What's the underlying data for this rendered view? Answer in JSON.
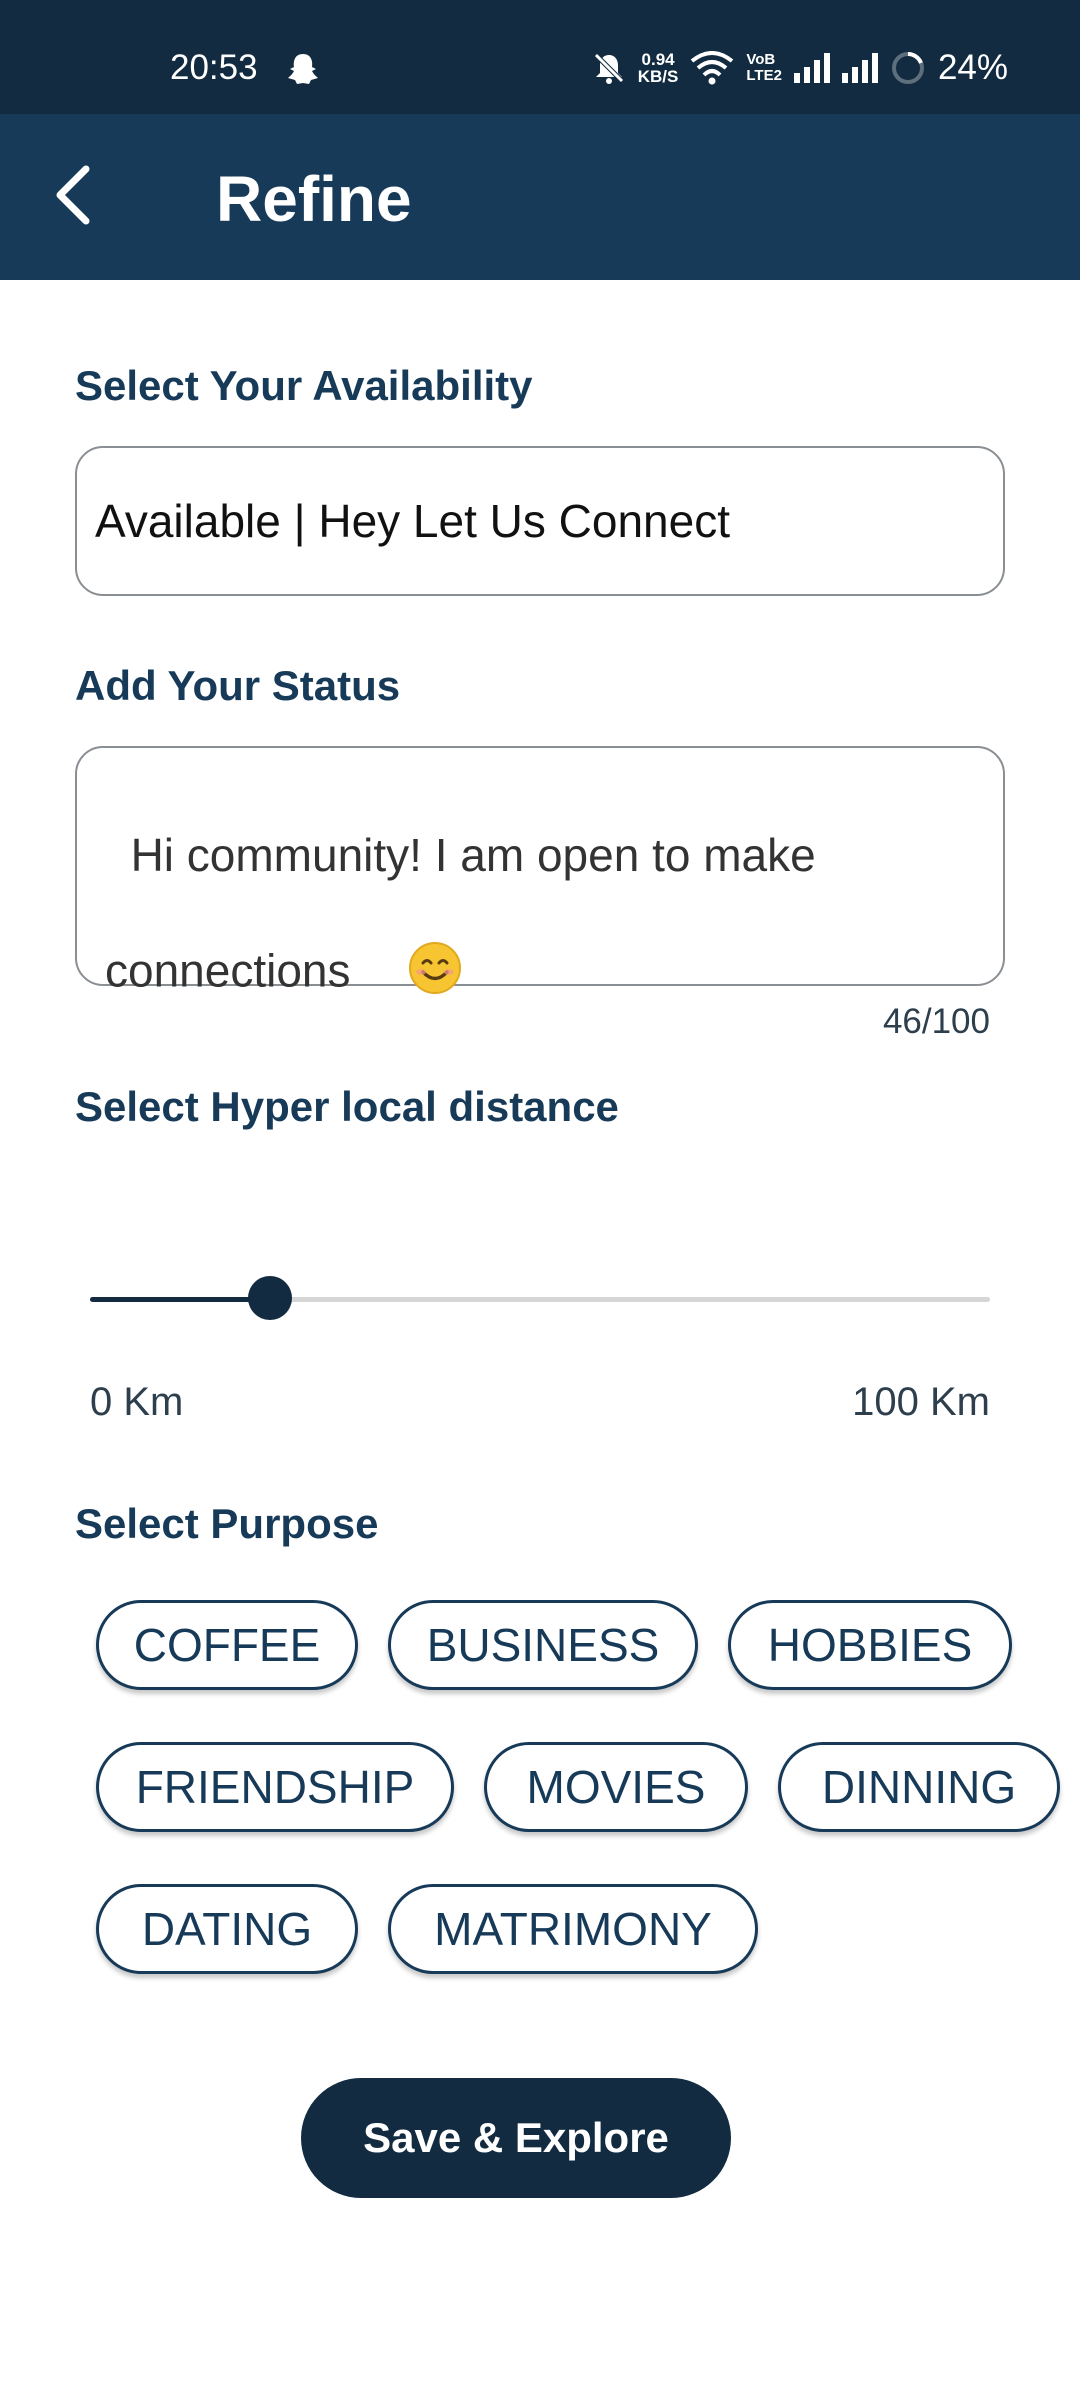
{
  "status_bar": {
    "time": "20:53",
    "net_speed_value": "0.94",
    "net_speed_unit": "KB/S",
    "volte_top": "VoB",
    "volte_bottom": "LTE2",
    "battery": "24%",
    "icons": [
      "snapchat-icon",
      "mute-icon",
      "wifi-icon",
      "signal-icon",
      "signal-icon",
      "battery-icon"
    ]
  },
  "app_bar": {
    "title": "Refine",
    "back_icon": "chevron-left-icon"
  },
  "availability": {
    "label": "Select Your Availability",
    "value": "Available | Hey Let Us Connect"
  },
  "status": {
    "label": "Add Your Status",
    "value": "Hi community! I am open to make connections",
    "emoji": "😊",
    "char_count": "46/100"
  },
  "distance": {
    "label": "Select Hyper local distance",
    "min_label": "0 Km",
    "max_label": "100 Km",
    "value_fraction": 0.2
  },
  "purpose": {
    "label": "Select Purpose",
    "rows": [
      [
        "COFFEE",
        "BUSINESS",
        "HOBBIES"
      ],
      [
        "FRIENDSHIP",
        "MOVIES",
        "DINNING"
      ],
      [
        "DATING",
        "MATRIMONY"
      ]
    ]
  },
  "actions": {
    "save_label": "Save & Explore"
  },
  "colors": {
    "status_bar_bg": "#122b40",
    "app_bar_bg": "#163a58",
    "accent": "#163a58"
  }
}
